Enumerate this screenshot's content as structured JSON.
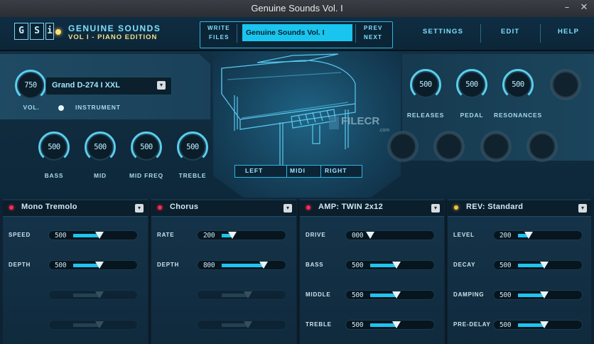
{
  "window": {
    "title": "Genuine Sounds Vol. I"
  },
  "brand": {
    "letters": [
      "G",
      "S",
      "i"
    ],
    "line1": "GENUINE SOUNDS",
    "line2": "VOL I - PIANO EDITION"
  },
  "header": {
    "write_label": "WRITE",
    "files_label": "FILES",
    "preset_name": "Genuine Sounds Vol. I",
    "prev_label": "PREV",
    "next_label": "NEXT",
    "settings_label": "SETTINGS",
    "edit_label": "EDIT",
    "help_label": "HELP"
  },
  "instrument": {
    "volume": "750",
    "name": "Grand D-274 I XXL",
    "vol_label": "VOL.",
    "instrument_label": "INSTRUMENT"
  },
  "eq": [
    {
      "label": "BASS",
      "value": "500"
    },
    {
      "label": "MID",
      "value": "500"
    },
    {
      "label": "MID FREQ",
      "value": "500"
    },
    {
      "label": "TREBLE",
      "value": "500"
    }
  ],
  "right_knobs": [
    {
      "label": "RELEASES",
      "value": "500"
    },
    {
      "label": "PEDAL",
      "value": "500"
    },
    {
      "label": "RESONANCES",
      "value": "500"
    }
  ],
  "output": {
    "left": "LEFT",
    "midi": "MIDI",
    "right": "RIGHT"
  },
  "watermark": {
    "text": "FILECR",
    "sub": ".com"
  },
  "fx": [
    {
      "title": "Mono Tremolo",
      "led": "#ff2a55",
      "params": [
        {
          "label": "SPEED",
          "value": "500",
          "level": 0.5
        },
        {
          "label": "DEPTH",
          "value": "500",
          "level": 0.5
        }
      ]
    },
    {
      "title": "Chorus",
      "led": "#ff2a55",
      "params": [
        {
          "label": "RATE",
          "value": "200",
          "level": 0.2
        },
        {
          "label": "DEPTH",
          "value": "800",
          "level": 0.8
        }
      ]
    },
    {
      "title": "AMP: TWIN 2x12",
      "led": "#ff2a55",
      "params": [
        {
          "label": "DRIVE",
          "value": "000",
          "level": 0.0
        },
        {
          "label": "BASS",
          "value": "500",
          "level": 0.5
        },
        {
          "label": "MIDDLE",
          "value": "500",
          "level": 0.5
        },
        {
          "label": "TREBLE",
          "value": "500",
          "level": 0.5
        }
      ]
    },
    {
      "title": "REV: Standard",
      "led": "#f0c43a",
      "params": [
        {
          "label": "LEVEL",
          "value": "200",
          "level": 0.2
        },
        {
          "label": "DECAY",
          "value": "500",
          "level": 0.5
        },
        {
          "label": "DAMPING",
          "value": "500",
          "level": 0.5
        },
        {
          "label": "PRE-DELAY",
          "value": "500",
          "level": 0.5
        }
      ]
    }
  ],
  "colors": {
    "accent": "#1fc3ee",
    "led_red": "#ff2a55",
    "led_yellow": "#f0c43a",
    "brand_yellow": "#f3e08a"
  }
}
